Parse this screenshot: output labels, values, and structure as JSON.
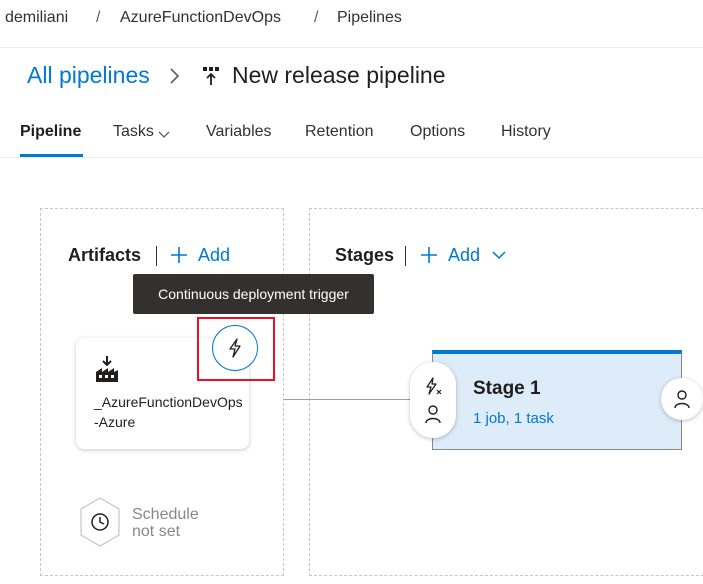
{
  "breadcrumb": {
    "items": [
      "demiliani",
      "AzureFunctionDevOps",
      "Pipelines"
    ],
    "separator": "/"
  },
  "header": {
    "all_pipelines_link": "All pipelines",
    "title": "New release pipeline"
  },
  "tabs": [
    {
      "label": "Pipeline",
      "active": true
    },
    {
      "label": "Tasks"
    },
    {
      "label": "Variables"
    },
    {
      "label": "Retention"
    },
    {
      "label": "Options"
    },
    {
      "label": "History"
    }
  ],
  "artifacts": {
    "heading": "Artifacts",
    "add_label": "Add",
    "tooltip": "Continuous deployment trigger",
    "artifact_name": "_AzureFunctionDevOps-Azure",
    "schedule_label": "Schedule not set"
  },
  "stages": {
    "heading": "Stages",
    "add_label": "Add",
    "stage_name": "Stage 1",
    "stage_summary": "1 job, 1 task"
  },
  "colors": {
    "accent": "#0078d4",
    "stage_fill": "#deecf9",
    "highlight": "#e81123",
    "tooltip_bg": "#323130"
  },
  "icons": [
    "chevron-right-icon",
    "release-pipeline-icon",
    "chevron-down-icon",
    "plus-icon",
    "lightning-icon",
    "build-artifact-icon",
    "clock-icon",
    "pre-deployment-trigger-icon",
    "person-icon"
  ]
}
